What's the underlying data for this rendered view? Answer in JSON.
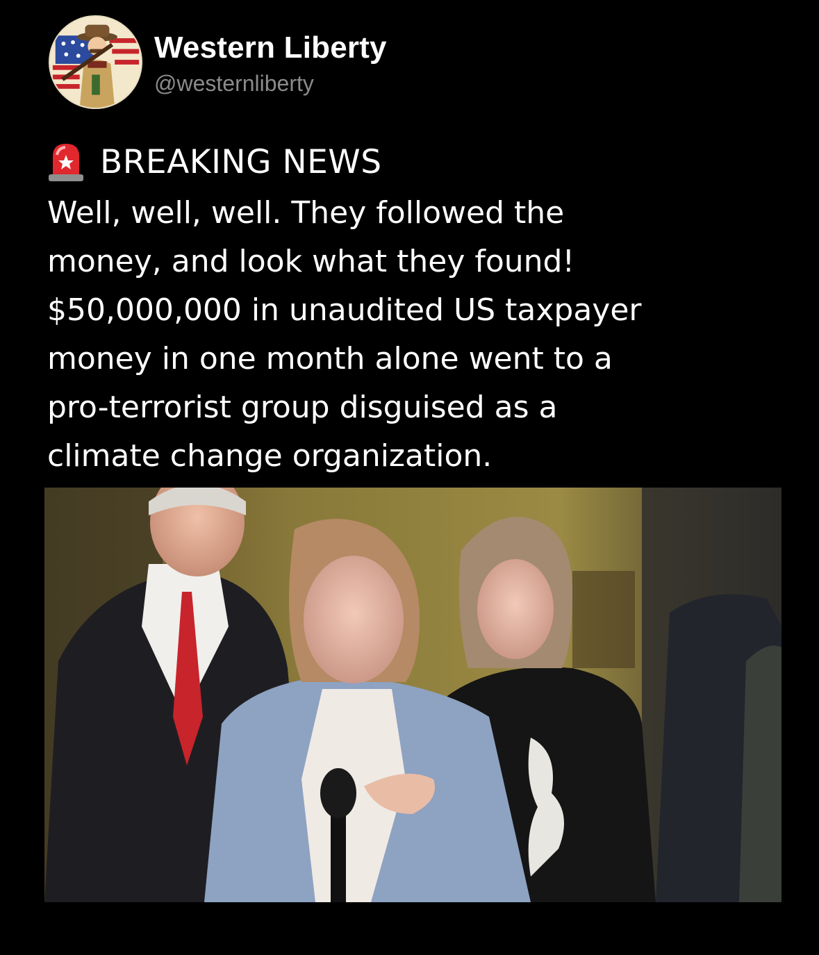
{
  "account": {
    "name": "Western Liberty",
    "handle": "@westernliberty",
    "avatar_icon": "patriot-cartoon-avatar"
  },
  "post": {
    "headline_icon": "police-siren-icon",
    "headline": "BREAKING NEWS",
    "body_lines": [
      "Well, well, well. They followed the",
      "money, and look what they found!",
      "$50,000,000 in unaudited US taxpayer",
      "money in one month alone went to a",
      "pro-terrorist group disguised as a",
      "climate change organization."
    ]
  },
  "media": {
    "type": "video-still",
    "description_icon": "press-conference-photo"
  },
  "colors": {
    "background": "#000000",
    "text": "#ffffff",
    "handle": "#8b8b8b",
    "siren_red": "#e0282e"
  }
}
